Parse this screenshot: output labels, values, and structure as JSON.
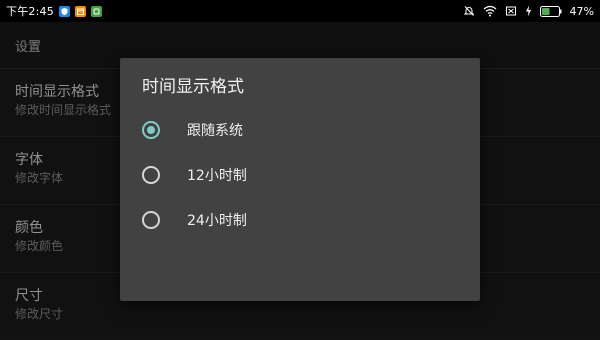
{
  "status_bar": {
    "time": "下午2:45",
    "battery_percent": "47%",
    "icons": [
      "shield-app-icon",
      "calendar-app-icon",
      "green-app-icon",
      "alarm-off-icon",
      "wifi-icon",
      "no-sim-icon",
      "charging-icon",
      "battery-icon"
    ],
    "battery_level": 0.47
  },
  "settings": {
    "header": "设置",
    "rows": [
      {
        "title": "时间显示格式",
        "subtitle": "修改时间显示格式"
      },
      {
        "title": "字体",
        "subtitle": "修改字体"
      },
      {
        "title": "颜色",
        "subtitle": "修改颜色"
      },
      {
        "title": "尺寸",
        "subtitle": "修改尺寸"
      }
    ]
  },
  "dialog": {
    "title": "时间显示格式",
    "options": [
      {
        "label": "跟随系统",
        "selected": true
      },
      {
        "label": "12小时制",
        "selected": false
      },
      {
        "label": "24小时制",
        "selected": false
      }
    ]
  },
  "colors": {
    "accent": "#80cbc4",
    "dialog_bg": "#424242",
    "app_bg": "#1b1b1b"
  }
}
